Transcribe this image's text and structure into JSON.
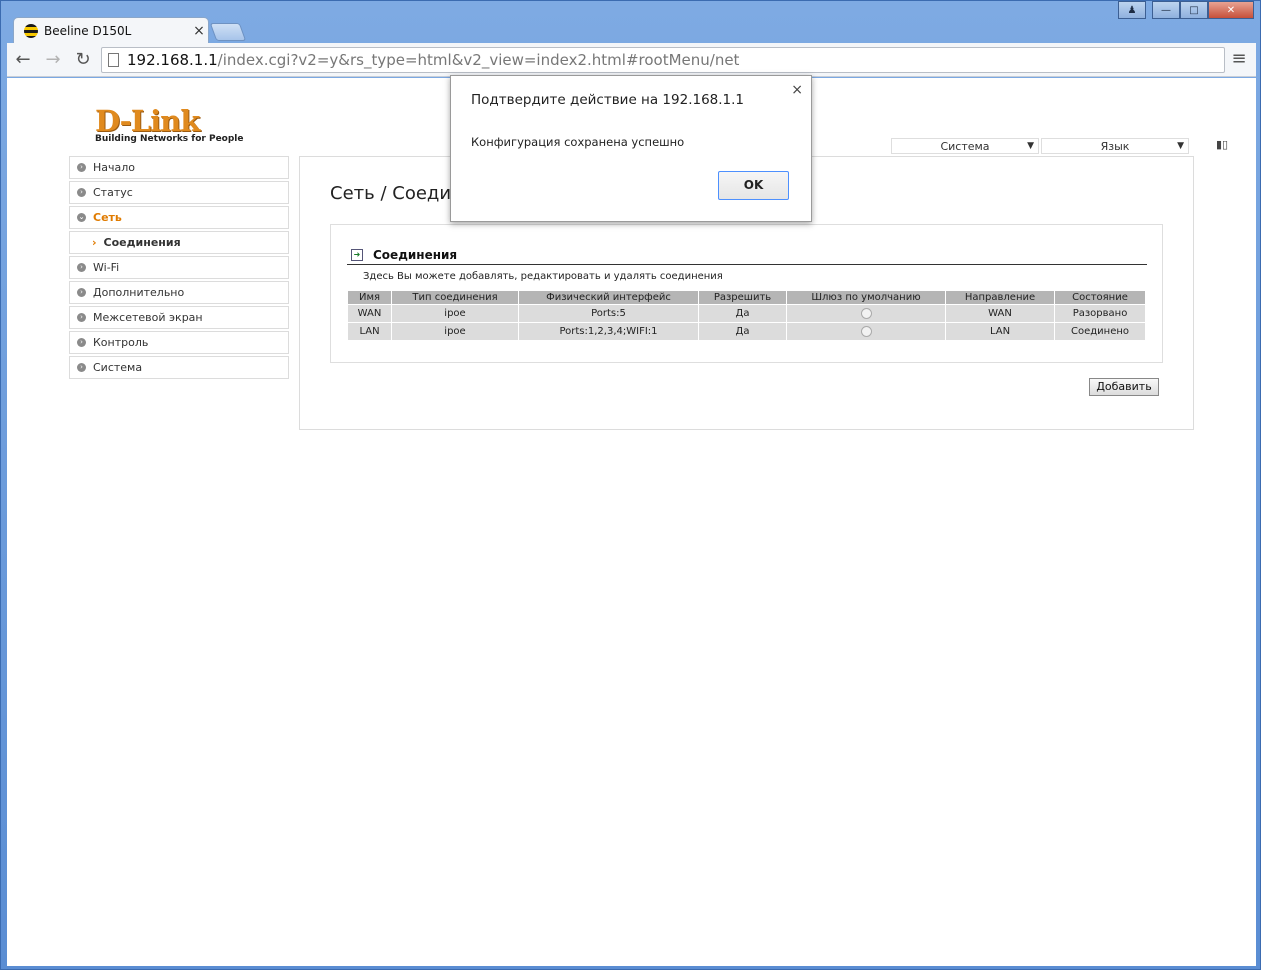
{
  "browser": {
    "tab_title": "Beeline D150L",
    "tab_close": "×",
    "url_host": "192.168.1.1",
    "url_path": "/index.cgi?v2=y&rs_type=html&v2_view=index2.html#rootMenu/net",
    "menu_icon": "≡",
    "back_icon": "←",
    "forward_icon": "→",
    "reload_icon": "↻"
  },
  "logo": {
    "main": "D-Link",
    "tagline": "Building Networks for People"
  },
  "top_selects": {
    "system": "Система",
    "language": "Язык"
  },
  "nav": {
    "items": [
      {
        "label": "Начало"
      },
      {
        "label": "Статус"
      },
      {
        "label": "Сеть",
        "active": true
      },
      {
        "label": "Соединения",
        "sub": true
      },
      {
        "label": "Wi-Fi"
      },
      {
        "label": "Дополнительно"
      },
      {
        "label": "Межсетевой экран"
      },
      {
        "label": "Контроль"
      },
      {
        "label": "Система"
      }
    ]
  },
  "content": {
    "page_title": "Сеть  /  Соединения",
    "panel_title": "Соединения",
    "panel_desc": "Здесь Вы можете добавлять, редактировать и удалять соединения",
    "table": {
      "headers": [
        "Имя",
        "Тип соединения",
        "Физический интерфейс",
        "Разрешить",
        "Шлюз по умолчанию",
        "Направление",
        "Состояние"
      ],
      "rows": [
        [
          "WAN",
          "ipoe",
          "Ports:5",
          "Да",
          "",
          "WAN",
          "Разорвано"
        ],
        [
          "LAN",
          "ipoe",
          "Ports:1,2,3,4;WIFI:1",
          "Да",
          "",
          "LAN",
          "Соединено"
        ]
      ]
    },
    "add_button": "Добавить"
  },
  "dialog": {
    "title": "Подтвердите действие на 192.168.1.1",
    "close": "×",
    "message": "Конфигурация сохранена успешно",
    "ok": "OK"
  }
}
